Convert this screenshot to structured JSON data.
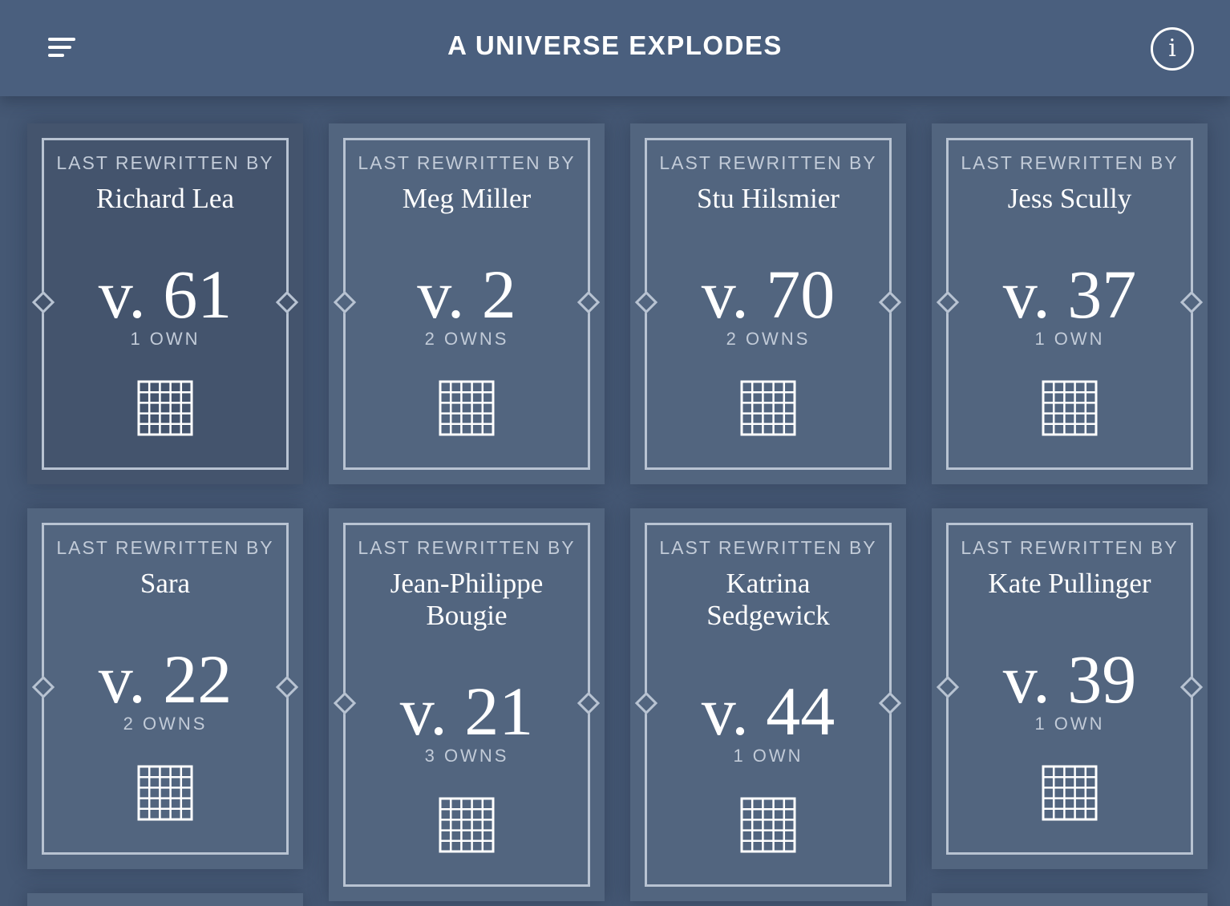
{
  "header": {
    "title": "A UNIVERSE EXPLODES",
    "menu_icon": "menu-icon",
    "info_icon": "info-icon",
    "info_glyph": "i"
  },
  "colors": {
    "background": "#455874",
    "header": "#4a5f7e",
    "card": "#52657f",
    "card_active": "#44546d",
    "frame": "#b8c3d2",
    "text": "#ffffff",
    "muted_text": "#c2cbd8"
  },
  "cards": [
    {
      "label": "LAST REWRITTEN BY",
      "author": "Richard Lea",
      "version": "v. 61",
      "owns": "1 OWN",
      "icon": "grid-icon"
    },
    {
      "label": "LAST REWRITTEN BY",
      "author": "Meg Miller",
      "version": "v. 2",
      "owns": "2 OWNS",
      "icon": "grid-icon"
    },
    {
      "label": "LAST REWRITTEN BY",
      "author": "Stu Hilsmier",
      "version": "v. 70",
      "owns": "2 OWNS",
      "icon": "grid-icon"
    },
    {
      "label": "LAST REWRITTEN BY",
      "author": "Jess Scully",
      "version": "v. 37",
      "owns": "1 OWN",
      "icon": "grid-icon"
    },
    {
      "label": "LAST REWRITTEN BY",
      "author": "Sara",
      "version": "v. 22",
      "owns": "2 OWNS",
      "icon": "grid-icon"
    },
    {
      "label": "LAST REWRITTEN BY",
      "author": "Jean-Philippe Bougie",
      "version": "v. 21",
      "owns": "3 OWNS",
      "icon": "grid-icon"
    },
    {
      "label": "LAST REWRITTEN BY",
      "author": "Katrina Sedgewick",
      "version": "v. 44",
      "owns": "1 OWN",
      "icon": "grid-icon"
    },
    {
      "label": "LAST REWRITTEN BY",
      "author": "Kate Pullinger",
      "version": "v. 39",
      "owns": "1 OWN",
      "icon": "grid-icon"
    }
  ]
}
